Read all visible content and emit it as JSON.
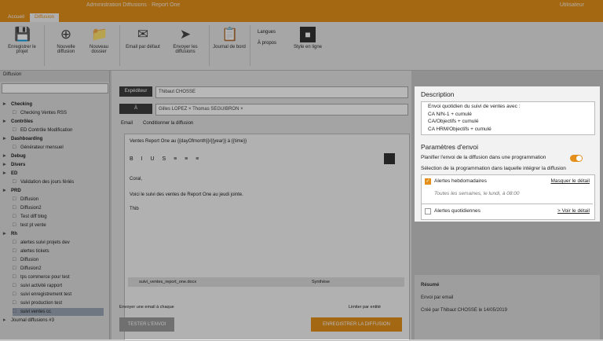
{
  "app": {
    "title": "Administration Diffusions · Report One",
    "user": "Utilisateur"
  },
  "tabs": [
    "Accueil",
    "Diffusion"
  ],
  "ribbon": {
    "buttons": [
      {
        "label": "Enregistrer le projet",
        "icon": "save-icon"
      },
      {
        "label": "Nouvelle diffusion",
        "icon": "add-icon"
      },
      {
        "label": "Nouveau dossier",
        "icon": "folder-icon"
      },
      {
        "label": "Email par défaut",
        "icon": "mail-icon"
      },
      {
        "label": "Envoyer les diffusions",
        "icon": "send-icon"
      },
      {
        "label": "Journal de bord",
        "icon": "journal-icon"
      },
      {
        "label": "Style en ligne",
        "icon": "style-icon"
      }
    ],
    "options": [
      "Langues",
      "À propos"
    ]
  },
  "left_panel": {
    "header": "Diffusion",
    "tree": [
      {
        "label": "Checking",
        "bold": true,
        "indent": 0
      },
      {
        "label": "Checking Ventes RSS",
        "bold": false,
        "indent": 1
      },
      {
        "label": "Contrôles",
        "bold": true,
        "indent": 0
      },
      {
        "label": "ED Contrôle Modification",
        "bold": false,
        "indent": 1
      },
      {
        "label": "Dashboarding",
        "bold": true,
        "indent": 0
      },
      {
        "label": "Générateur mensuel",
        "bold": false,
        "indent": 1
      },
      {
        "label": "Debug",
        "bold": true,
        "indent": 0
      },
      {
        "label": "Divers",
        "bold": true,
        "indent": 0
      },
      {
        "label": "ED",
        "bold": true,
        "indent": 0
      },
      {
        "label": "Validation des jours fériés",
        "bold": false,
        "indent": 1
      },
      {
        "label": "PRD",
        "bold": true,
        "indent": 0
      },
      {
        "label": "Diffusion",
        "bold": false,
        "indent": 1
      },
      {
        "label": "Diffusion2",
        "bold": false,
        "indent": 1
      },
      {
        "label": "Test diff blog",
        "bold": false,
        "indent": 1
      },
      {
        "label": "test pt vente",
        "bold": false,
        "indent": 1
      },
      {
        "label": "Rh",
        "bold": true,
        "indent": 0
      },
      {
        "label": "alertes suivi projets dev",
        "bold": false,
        "indent": 1
      },
      {
        "label": "alertes tickets",
        "bold": false,
        "indent": 1
      },
      {
        "label": "Diffusion",
        "bold": false,
        "indent": 1
      },
      {
        "label": "Diffusion2",
        "bold": false,
        "indent": 1
      },
      {
        "label": "tps commerce pour test",
        "bold": false,
        "indent": 1
      },
      {
        "label": "suivi activité rapport",
        "bold": false,
        "indent": 1
      },
      {
        "label": "suivi enregistrement test",
        "bold": false,
        "indent": 1
      },
      {
        "label": "suivi production test",
        "bold": false,
        "indent": 1
      },
      {
        "label": "suivi ventes cc",
        "bold": false,
        "indent": 1,
        "selected": true
      },
      {
        "label": "Journal diffusions #3",
        "bold": false,
        "indent": 0
      }
    ]
  },
  "middle": {
    "expediteur_label": "Expéditeur",
    "expediteur_value": "Thibaut CHOSSE",
    "a_label": "À",
    "recipients": "Gilles LOPEZ ×   Thomas SEGUIBRON ×",
    "tabs": [
      "Email",
      "Conditionner la diffusion"
    ],
    "subject": "Ventes Report One au {{dayOfmonth}}/{{year}} à {{time}}",
    "body_greeting": "Coral,",
    "body_text": "Voici le suivi des ventes de Report One au jeudi jointe.",
    "body_sign": "Thib",
    "attachment": "suivi_ventes_report_one.docx",
    "attachment_format": "Synthèse",
    "send_one_label": "Envoyer une email à chaque",
    "send_one_right": "Limiter par entité",
    "test_button": "TESTER L'ENVOI",
    "save_button": "ENREGISTRER LA DIFFUSION"
  },
  "right_panel": {
    "description_title": "Description",
    "description_lines": [
      "Envoi quotidien du suivi de ventes avec :",
      "CA N/N-1 + cumulé",
      "CA/Objectifs + cumulé",
      "CA HRM/Objectifs + cumulé"
    ],
    "params_title": "Paramètres d'envoi",
    "plan_label": "Planifier l'envoi de la diffusion dans une programmation",
    "plan_enabled": true,
    "select_label": "Sélection de la programmation dans laquelle intégrer la diffusion",
    "alerts": [
      {
        "label": "Alertes hebdomadaires",
        "checked": true,
        "link": "Masquer le détail",
        "detail": "Toutes les semaines, le lundi, à 08:00"
      },
      {
        "label": "Alertes quotidiennes",
        "checked": false,
        "link": "> Voir le détail"
      }
    ],
    "accent_color": "#e48f1a"
  },
  "summary": {
    "title": "Résumé",
    "line1": "Envoi par email",
    "line2": "Créé par Thibaut CHOSSE le 14/05/2019"
  }
}
